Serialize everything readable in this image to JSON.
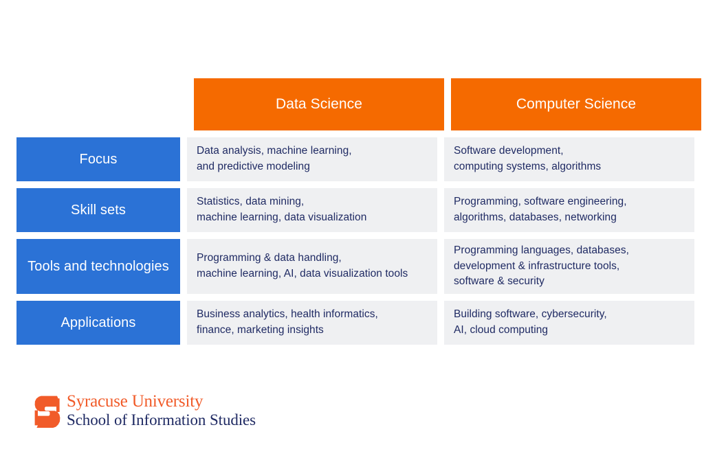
{
  "colors": {
    "header_orange": "#F56A00",
    "label_blue": "#2B72D6",
    "cell_gray": "#EFF0F2",
    "body_navy": "#1F2A63",
    "logo_orange": "#F15B29",
    "background": "#FFFFFF"
  },
  "table": {
    "columns": [
      {
        "key": "label",
        "header": ""
      },
      {
        "key": "data_science",
        "header": "Data Science"
      },
      {
        "key": "computer_science",
        "header": "Computer Science"
      }
    ],
    "rows": [
      {
        "label": "Focus",
        "data_science": [
          "Data analysis, machine learning,",
          "and predictive modeling"
        ],
        "computer_science": [
          "Software development,",
          "computing systems, algorithms"
        ]
      },
      {
        "label": "Skill sets",
        "data_science": [
          "Statistics, data mining,",
          "machine learning, data visualization"
        ],
        "computer_science": [
          "Programming, software engineering,",
          "algorithms, databases, networking"
        ]
      },
      {
        "label": "Tools and technologies",
        "data_science": [
          "Programming & data handling,",
          "machine learning, AI, data visualization tools"
        ],
        "computer_science": [
          "Programming languages, databases,",
          "development & infrastructure tools,",
          "software & security"
        ]
      },
      {
        "label": "Applications",
        "data_science": [
          "Business analytics, health informatics,",
          "finance, marketing insights"
        ],
        "computer_science": [
          "Building software, cybersecurity,",
          "AI, cloud computing"
        ]
      }
    ]
  },
  "logo": {
    "icon": "syracuse-block-s-icon",
    "line_1": "Syracuse University",
    "line_2": "School of Information Studies"
  }
}
